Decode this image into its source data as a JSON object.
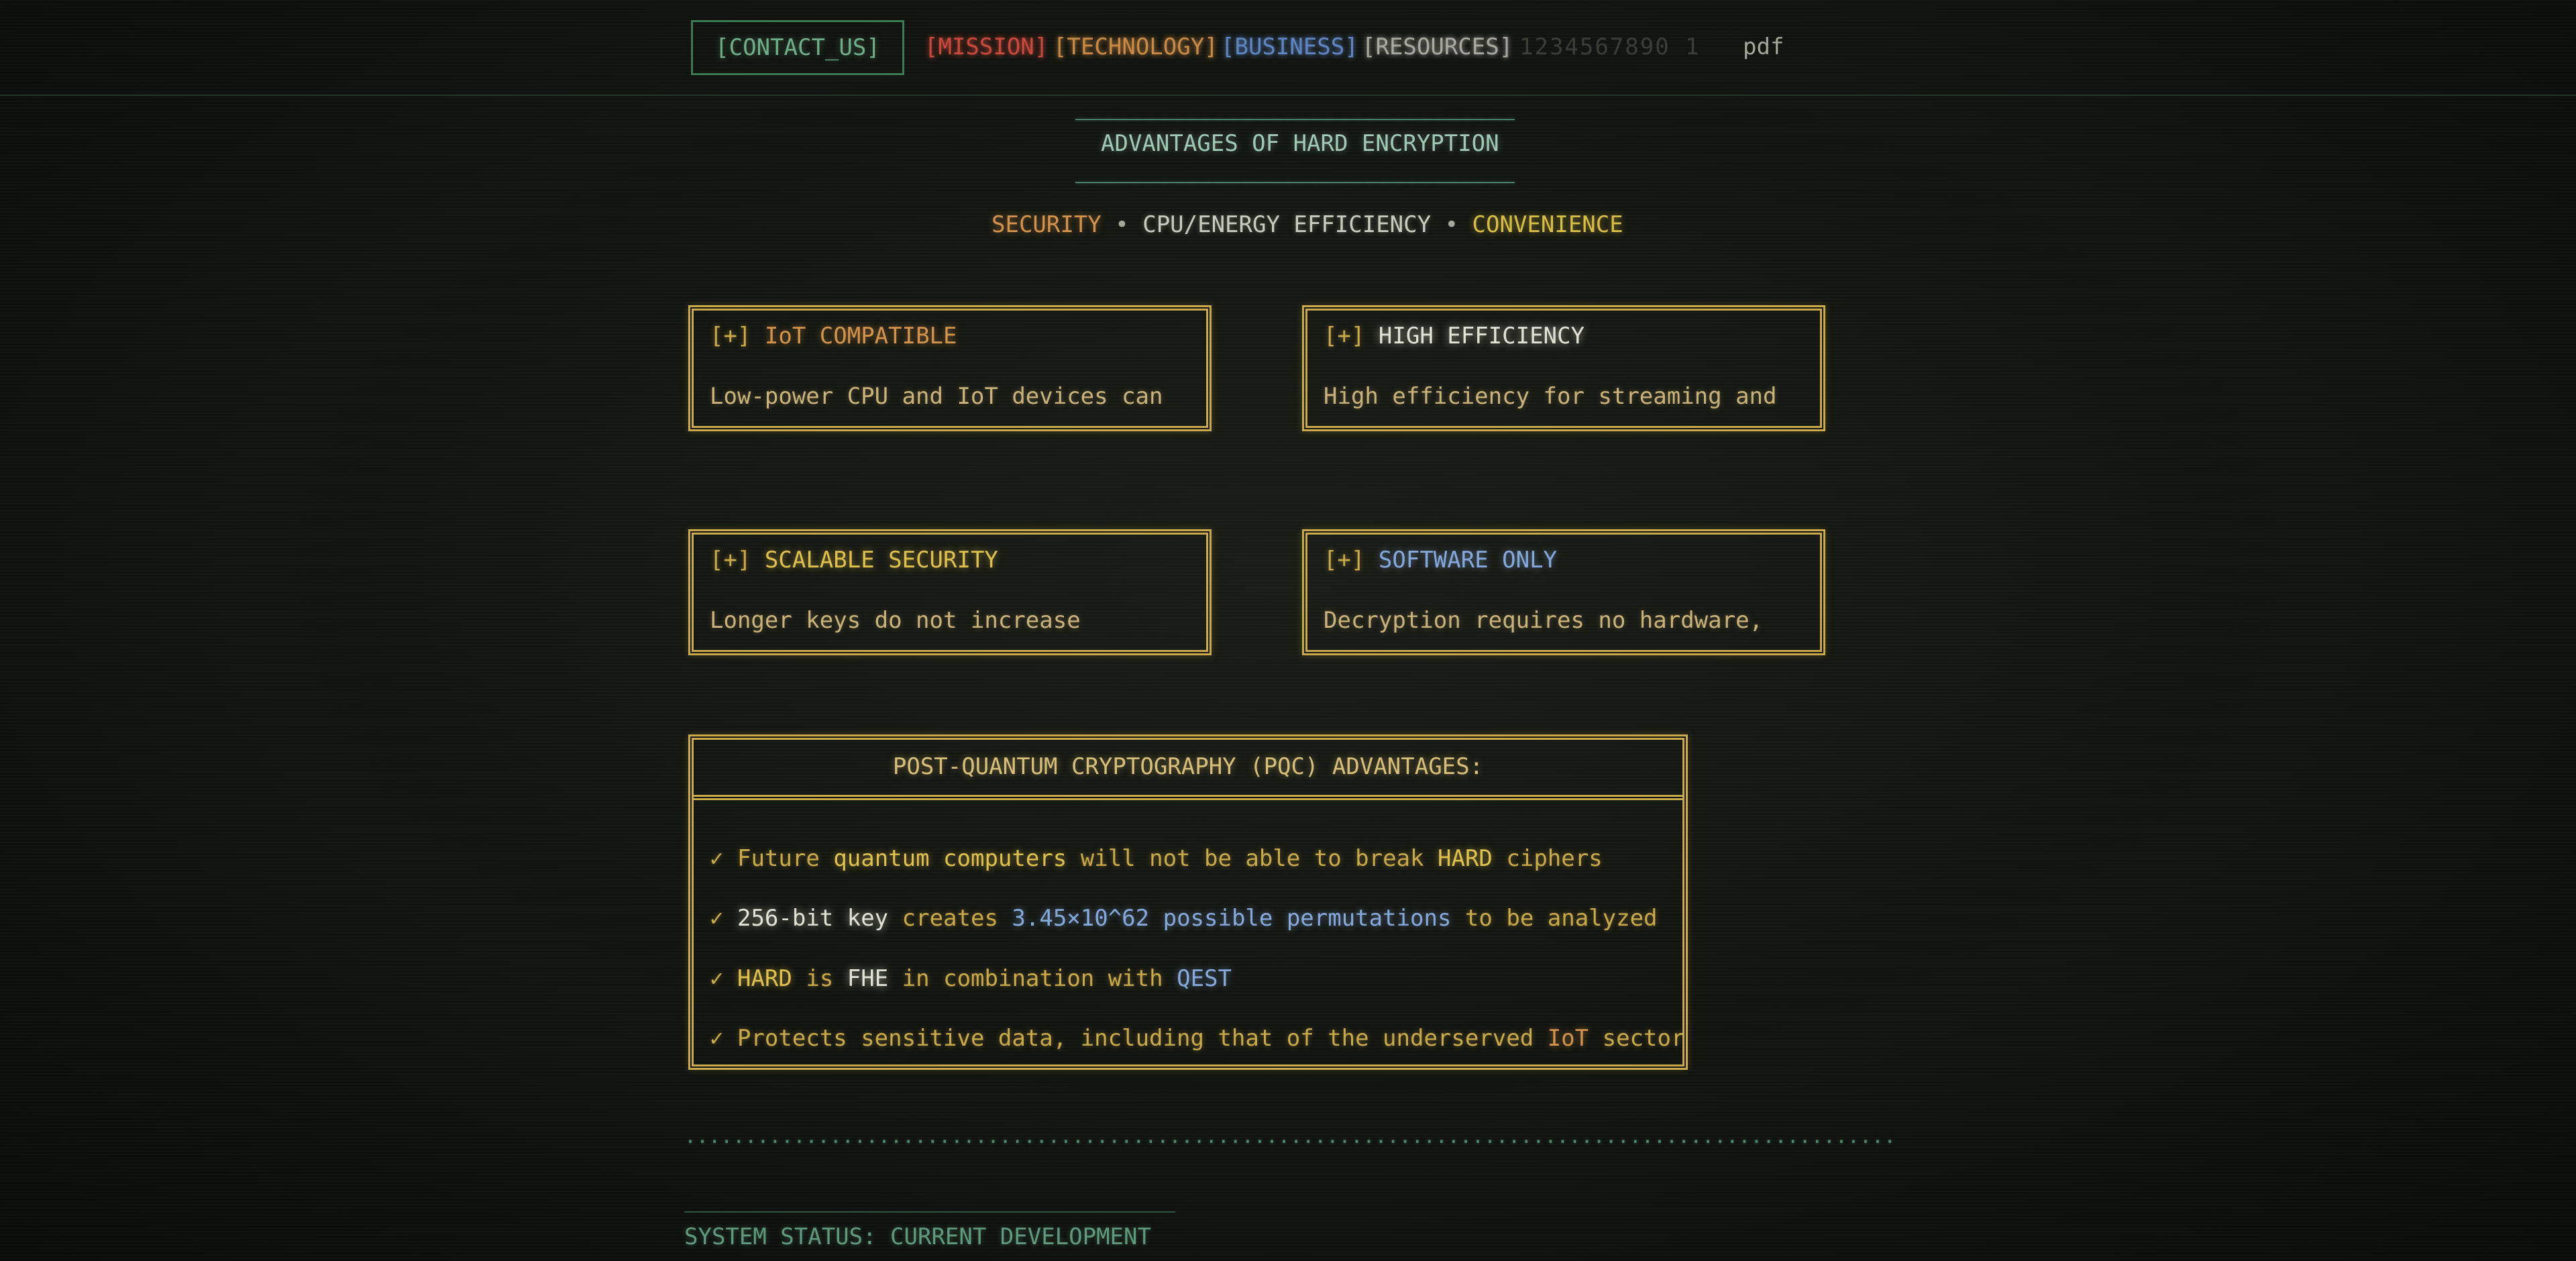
{
  "nav": {
    "contact": "[CONTACT_US]",
    "mission": "[MISSION]",
    "technology": "[TECHNOLOGY]",
    "business": "[BUSINESS]",
    "resources": "[RESOURCES]",
    "digits": "1234567890 1",
    "pdf": "pdf"
  },
  "header": {
    "rule": "________________________________",
    "title": "ADVANTAGES OF HARD ENCRYPTION",
    "tags": [
      "SECURITY",
      "•",
      "CPU/ENERGY EFFICIENCY",
      "•",
      "CONVENIENCE"
    ]
  },
  "cards": [
    {
      "prefix": "[+]",
      "title": "IoT COMPATIBLE",
      "body": "Low-power CPU and IoT devices can"
    },
    {
      "prefix": "[+]",
      "title": "HIGH EFFICIENCY",
      "body": "High efficiency for streaming and"
    },
    {
      "prefix": "[+]",
      "title": "SCALABLE SECURITY",
      "body": "Longer keys do not increase"
    },
    {
      "prefix": "[+]",
      "title": "SOFTWARE ONLY",
      "body": "Decryption requires no hardware,"
    }
  ],
  "pqc": {
    "title": "POST-QUANTUM CRYPTOGRAPHY (PQC) ADVANTAGES:",
    "check": "✓",
    "rows": [
      [
        "Future",
        "quantum computers",
        "will not be able to break",
        "HARD",
        "ciphers"
      ],
      [
        "256-bit key",
        "creates",
        "3.45×10^62",
        "possible permutations",
        "to be analyzed"
      ],
      [
        "HARD",
        "is",
        "FHE",
        "in combination with",
        "QEST"
      ],
      [
        "Protects sensitive data, including that of the underserved",
        "IoT",
        "sector"
      ]
    ]
  },
  "footer": {
    "dots": "....................................................................................................",
    "rule": "______________________________________",
    "status": "SYSTEM STATUS: CURRENT DEVELOPMENT"
  }
}
